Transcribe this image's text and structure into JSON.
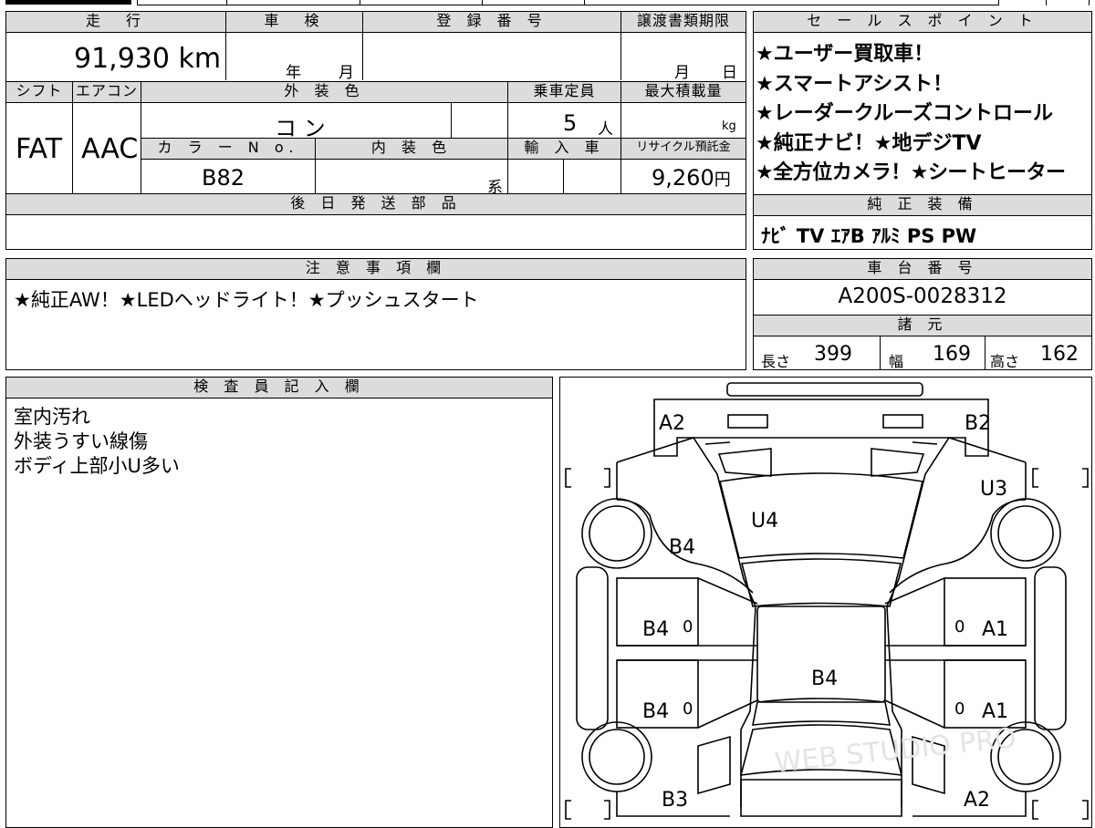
{
  "top_strip": {
    "present": true
  },
  "vehicle": {
    "mileage_header": "走　行",
    "mileage": "91,930",
    "mileage_unit": "km",
    "inspection_header": "車　検",
    "inspection_year": "年",
    "inspection_month": "月",
    "registration_header": "登 録 番 号",
    "transfer_header": "譲渡書類期限",
    "transfer_month": "月",
    "transfer_day": "日",
    "shift_header": "シフト",
    "shift": "FAT",
    "ac_header": "エアコン",
    "ac": "AAC",
    "exterior_header": "外 装 色",
    "exterior_color": "コ ン",
    "capacity_header": "乗車定員",
    "capacity": "5",
    "capacity_unit": "人",
    "maxload_header": "最大積載量",
    "maxload_unit": "kg",
    "colorno_header": "カ ラ ー N o.",
    "colorno": "B82",
    "interior_header": "内 装 色",
    "interior_suffix": "系",
    "import_header": "輸 入 車",
    "recycle_header": "リサイクル預託金",
    "recycle_amount": "9,260",
    "recycle_unit": "円",
    "later_parts_header": "後 日 発 送 部 品"
  },
  "sales_points": {
    "header": "セ ー ル ス ポ イ ン ト",
    "lines": [
      "★ユーザー買取車！",
      "★スマートアシスト！",
      "★レーダークルーズコントロール",
      "★純正ナビ！★地デジTV",
      "★全方位カメラ！★シートヒーター"
    ]
  },
  "genuine_equipment": {
    "header": "純 正 装 備",
    "value": "ﾅﾋﾞ TV ｴｱB ｱﾙﾐ PS PW"
  },
  "notes": {
    "header": "注 意 事 項 欄",
    "text": "★純正AW！★LEDヘッドライト！★プッシュスタート"
  },
  "chassis": {
    "header": "車 台 番 号",
    "number": "A200S-0028312"
  },
  "specs": {
    "header": "諸 元",
    "length_label": "長さ",
    "length": "399",
    "width_label": "幅",
    "width": "169",
    "height_label": "高さ",
    "height": "162"
  },
  "inspector": {
    "header": "検 査 員 記 入 欄",
    "lines": [
      "室内汚れ",
      "外装うすい線傷",
      "ボディ上部小U多い"
    ]
  },
  "diagram": {
    "labels": {
      "front_left": "A2",
      "front_right": "B2",
      "hood": "U4",
      "fender_left": "B4",
      "fender_right": "U3",
      "front_door_left": "B4",
      "rear_door_left": "B4",
      "front_door_right": "A1",
      "rear_door_right": "A1",
      "roof": "B4",
      "rear_left": "B3",
      "rear_right": "A2",
      "door_mark": "0"
    },
    "watermark": "WEB STUDIO PRO"
  }
}
